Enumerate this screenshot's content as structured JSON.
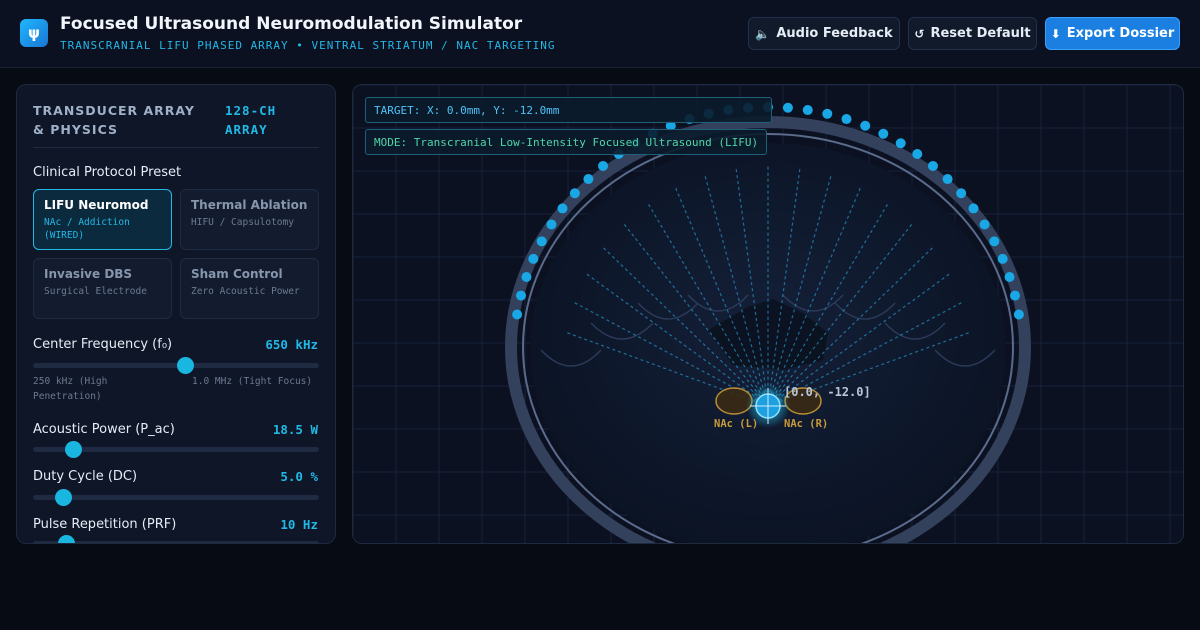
{
  "header": {
    "logo_glyph": "ψ",
    "title": "Focused Ultrasound Neuromodulation Simulator",
    "subtitle": "TRANSCRANIAL LIFU PHASED ARRAY • VENTRAL STRIATUM / NAC TARGETING",
    "buttons": {
      "audio": {
        "icon": "speaker-icon",
        "glyph": "🔈",
        "label": "Audio Feedback"
      },
      "reset": {
        "icon": "reset-icon",
        "glyph": "↺",
        "label": "Reset Default"
      },
      "export": {
        "icon": "download-icon",
        "glyph": "⬇",
        "label": "Export Dossier"
      }
    }
  },
  "panel": {
    "title": "TRANSDUCER ARRAY & PHYSICS",
    "badge": "128-CH ARRAY",
    "preset_section_label": "Clinical Protocol Preset",
    "presets": [
      {
        "name": "LIFU Neuromod",
        "desc": "NAc / Addiction (WIRED)",
        "active": true
      },
      {
        "name": "Thermal Ablation",
        "desc": "HIFU / Capsulotomy",
        "active": false
      },
      {
        "name": "Invasive DBS",
        "desc": "Surgical Electrode",
        "active": false
      },
      {
        "name": "Sham Control",
        "desc": "Zero Acoustic Power",
        "active": false
      }
    ],
    "controls": [
      {
        "label": "Center Frequency (f₀)",
        "value": "650 kHz",
        "fraction": 0.53,
        "min_hint": "250 kHz (High Penetration)",
        "max_hint": "1.0 MHz (Tight Focus)"
      },
      {
        "label": "Acoustic Power (P_ac)",
        "value": "18.5 W",
        "fraction": 0.14
      },
      {
        "label": "Duty Cycle (DC)",
        "value": "5.0 %",
        "fraction": 0.105
      },
      {
        "label": "Pulse Repetition (PRF)",
        "value": "10 Hz",
        "fraction": 0.115
      }
    ]
  },
  "viewport": {
    "hud_target": "TARGET: X: 0.0mm, Y: -12.0mm",
    "hud_mode": "MODE: Transcranial Low-Intensity Focused Ultrasound (LIFU)",
    "focus_readout": "[0.0, -12.0]",
    "nuclei": {
      "left": "NAc (L)",
      "right": "NAc (R)"
    },
    "colors": {
      "element": "#19a7e6",
      "skull": "#4a5a78",
      "beam": "#2aa8e0",
      "nucleus": "#c99a3a"
    }
  }
}
